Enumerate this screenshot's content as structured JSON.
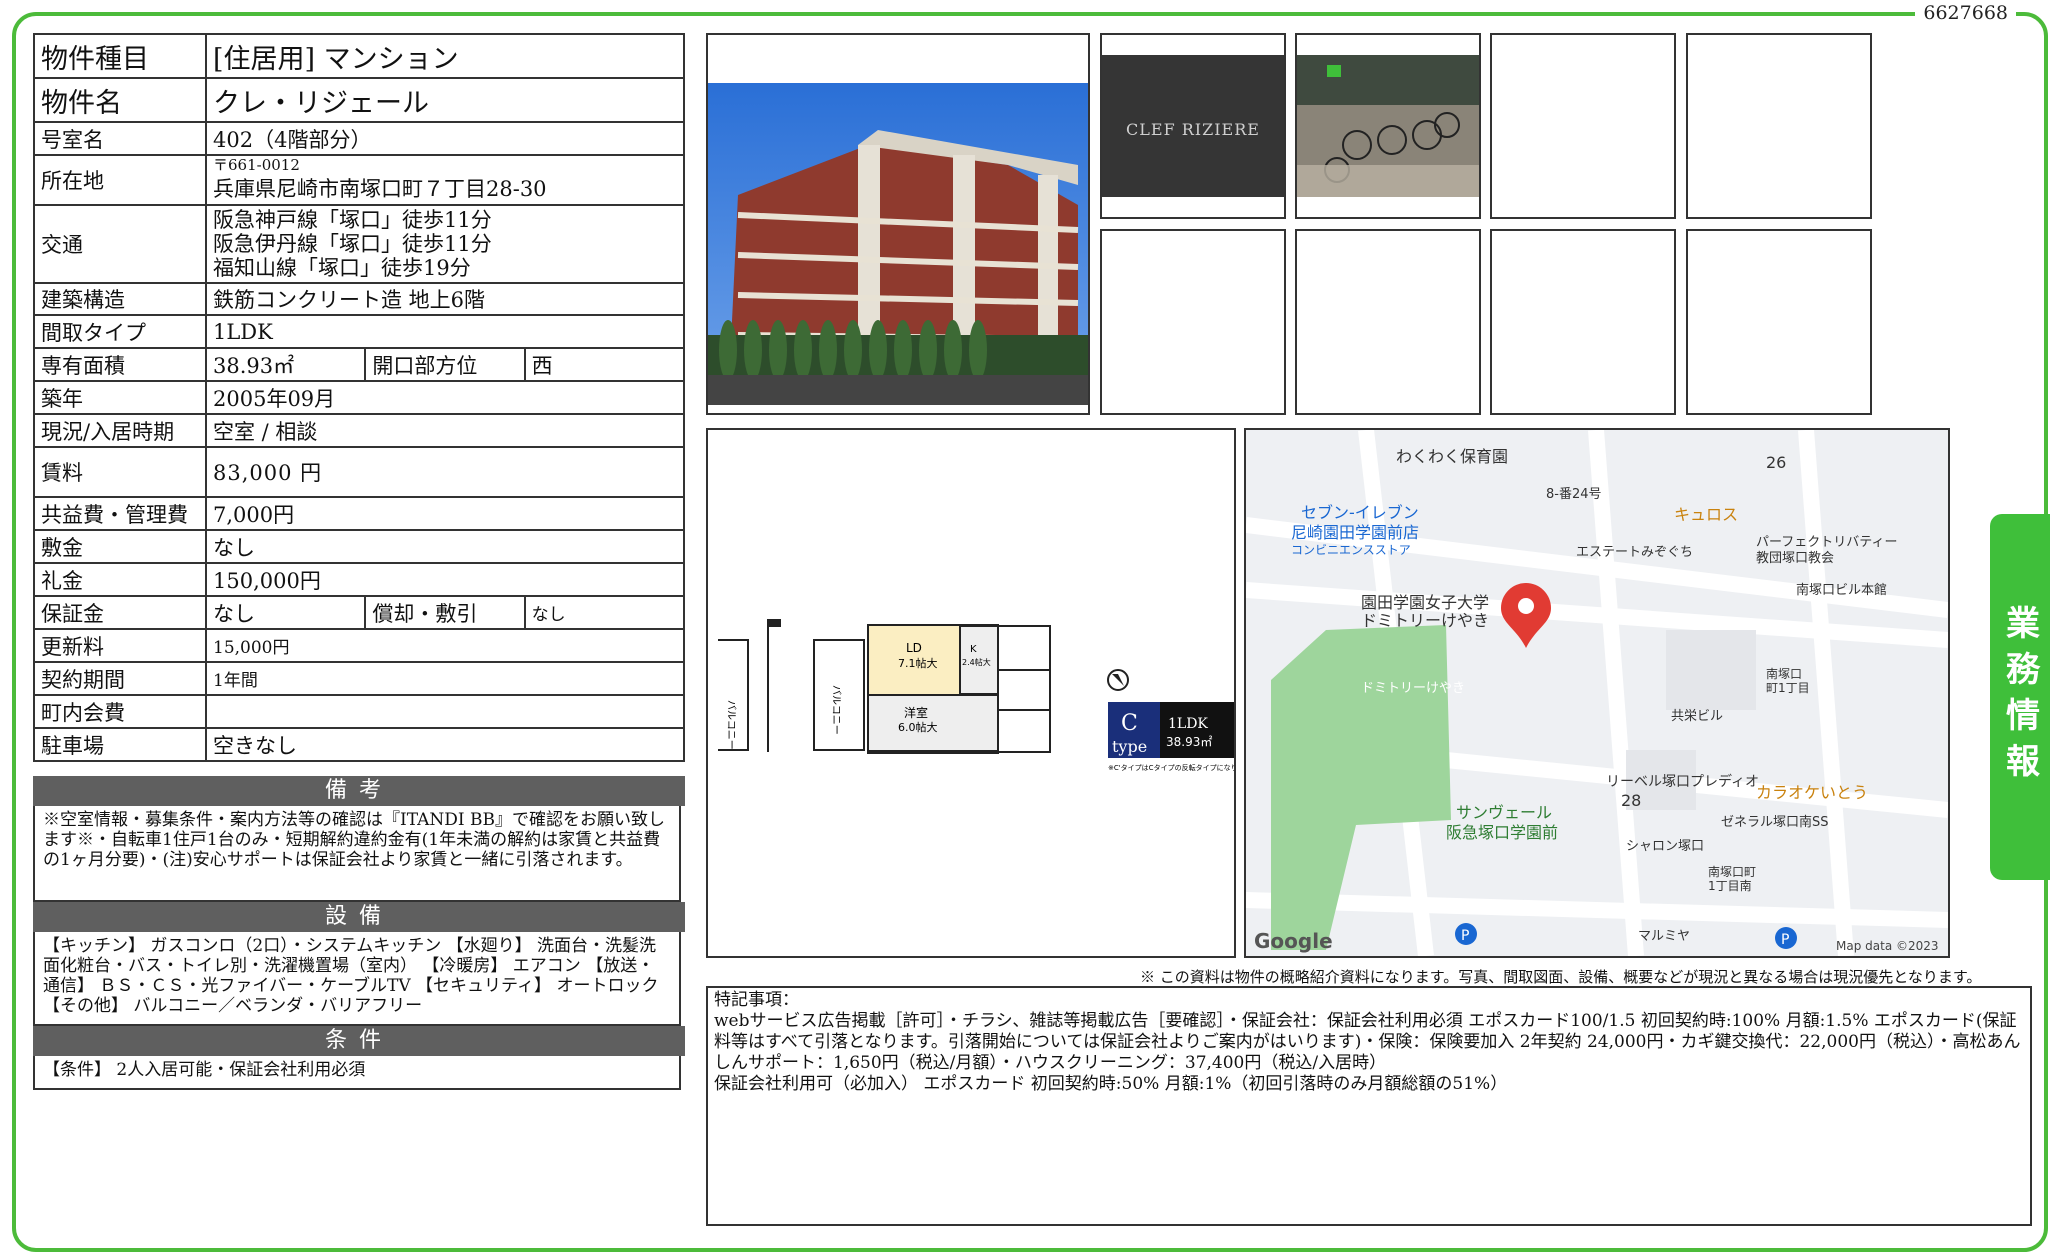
{
  "doc_number": "6627668",
  "side_tab": "業務情報",
  "table": {
    "rows": [
      {
        "label": "物件種目",
        "value": "[住居用] マンション"
      },
      {
        "label": "物件名",
        "value": "クレ・リジェール"
      },
      {
        "label": "号室名",
        "value": "402（4階部分）"
      },
      {
        "label": "所在地",
        "postal": "〒661-0012",
        "value": "兵庫県尼崎市南塚口町７丁目28-30"
      },
      {
        "label": "交通",
        "lines": [
          "阪急神戸線「塚口」徒歩11分",
          "阪急伊丹線「塚口」徒歩11分",
          "福知山線「塚口」徒歩19分"
        ]
      },
      {
        "label": "建築構造",
        "value": "鉄筋コンクリート造 地上6階"
      },
      {
        "label": "間取タイプ",
        "value": "1LDK"
      },
      {
        "label": "専有面積",
        "value": "38.93㎡",
        "sub_label": "開口部方位",
        "sub_value": "西"
      },
      {
        "label": "築年",
        "value": "2005年09月"
      },
      {
        "label": "現況/入居時期",
        "value": "空室 / 相談"
      },
      {
        "label": "賃料",
        "value": "83,000 円"
      },
      {
        "label": "共益費・管理費",
        "value": "7,000円"
      },
      {
        "label": "敷金",
        "value": "なし"
      },
      {
        "label": "礼金",
        "value": "150,000円"
      },
      {
        "label": "保証金",
        "value": "なし",
        "sub_label": "償却・敷引",
        "sub_value": "なし"
      },
      {
        "label": "更新料",
        "value": "15,000円"
      },
      {
        "label": "契約期間",
        "value": "1年間"
      },
      {
        "label": "町内会費",
        "value": ""
      },
      {
        "label": "駐車場",
        "value": "空きなし"
      }
    ]
  },
  "sections": {
    "remarks_title": "備考",
    "remarks_text": "※空室情報・募集条件・案内方法等の確認は『ITANDI BB』で確認をお願い致します※・自転車1住戸1台のみ・短期解約違約金有(1年未満の解約は家賃と共益費の1ヶ月分要)・(注)安心サポートは保証会社より家賃と一緒に引落されます。",
    "equipment_title": "設備",
    "equipment_text": "【キッチン】 ガスコンロ（2口）・システムキッチン 【水廻り】 洗面台・洗髪洗面化粧台・バス・トイレ別・洗濯機置場（室内） 【冷暖房】 エアコン 【放送・通信】 ＢＳ・ＣＳ・光ファイバー・ケーブルTV 【セキュリティ】 オートロック 【その他】 バルコニー／ベランダ・バリアフリー",
    "conditions_title": "条件",
    "conditions_text": "【条件】 2人入居可能・保証会社利用必須"
  },
  "floorplan": {
    "balcony1": "バルコニー",
    "balcony2": "バルコニー",
    "ld": "LD",
    "ld_size": "7.1帖大",
    "k": "K",
    "k_size": "2.4帖大",
    "yoshitsu": "洋室",
    "yoshitsu_size": "6.0帖大",
    "type_letter": "C",
    "type_word": "type",
    "layout": "1LDK",
    "area": "38.93㎡",
    "note": "※C'タイプはCタイプの反転タイプになります。"
  },
  "map": {
    "labels": [
      "わくわく保育園",
      "26",
      "8-番24号",
      "キュロス",
      "セブン-イレブン",
      "尼崎園田学園前店",
      "コンビニエンスストア",
      "エステートみぞぐち",
      "パーフェクトリバティー",
      "教団塚口教会",
      "南塚口ビル本館",
      "園田学園女子大学",
      "ドミトリーけやき",
      "ドミトリーけやき",
      "南塚口",
      "町1丁目",
      "共栄ビル",
      "リーベル塚口プレディオ",
      "28",
      "カラオケいとう",
      "サンヴェール",
      "阪急塚口学園前",
      "ゼネラル塚口南SS",
      "シャロン塚口",
      "南塚口町",
      "1丁目南",
      "マルミヤ"
    ],
    "google": "Google",
    "credit": "Map data ©2023"
  },
  "disclaimer": "※ この資料は物件の概略紹介資料になります。写真、間取図面、設備、概要などが現況と異なる場合は現況優先となります。",
  "notes": {
    "title": "特記事項：",
    "lines": [
      "webサービス広告掲載［許可］・チラシ、雑誌等掲載広告［要確認］・保証会社：保証会社利用必須 エポスカード100/1.5 初回契約時:100% 月額:1.5% エポスカード(保証料等はすべて引落となります。引落開始については保証会社よりご案内がはいります)・保険：保険要加入 2年契約 24,000円・カギ鍵交換代：22,000円（税込）・高松あんしんサポート：1,650円（税込/月額）・ハウスクリーニング：37,400円（税込/入居時）",
      "保証会社利用可（必加入） エポスカード 初回契約時:50% 月額:1%（初回引落時のみ月額総額の51%）"
    ]
  },
  "photo2_sign": "CLEF RIZIERE"
}
